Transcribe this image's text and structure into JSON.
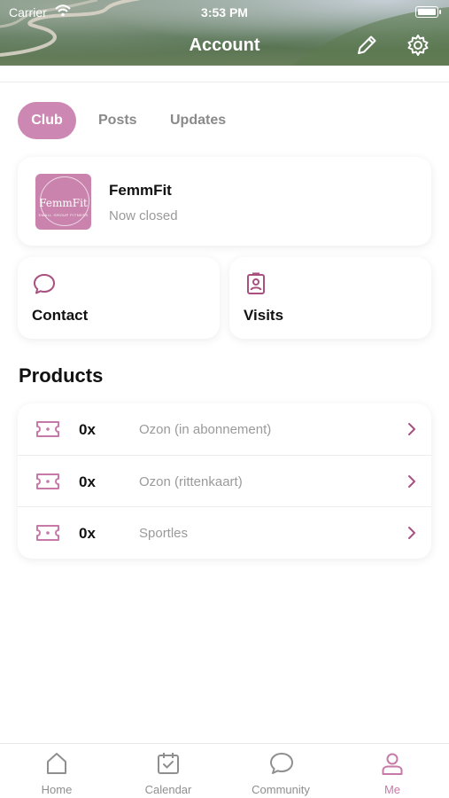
{
  "status_bar": {
    "carrier": "Carrier",
    "time": "3:53 PM"
  },
  "header": {
    "title": "Account"
  },
  "tabs": [
    {
      "label": "Club",
      "selected": true
    },
    {
      "label": "Posts",
      "selected": false
    },
    {
      "label": "Updates",
      "selected": false
    }
  ],
  "club": {
    "logo_text": "FemmFit",
    "logo_subtext": "SMALL GROUP FITNESS",
    "name": "FemmFit",
    "status": "Now closed"
  },
  "actions": [
    {
      "label": "Contact",
      "icon": "chat-bubble-icon"
    },
    {
      "label": "Visits",
      "icon": "id-badge-icon"
    }
  ],
  "products": {
    "heading": "Products",
    "items": [
      {
        "qty": "0x",
        "name": "Ozon (in abonnement)"
      },
      {
        "qty": "0x",
        "name": "Ozon (rittenkaart)"
      },
      {
        "qty": "0x",
        "name": "Sportles"
      }
    ]
  },
  "tabbar": [
    {
      "label": "Home",
      "icon": "home-icon"
    },
    {
      "label": "Calendar",
      "icon": "calendar-icon"
    },
    {
      "label": "Community",
      "icon": "chat-bubble-icon"
    },
    {
      "label": "Me",
      "icon": "person-icon",
      "active": true
    }
  ],
  "colors": {
    "accent": "#cc87b3",
    "accent_dark": "#a8507f",
    "muted_text": "#9a9a9a"
  }
}
